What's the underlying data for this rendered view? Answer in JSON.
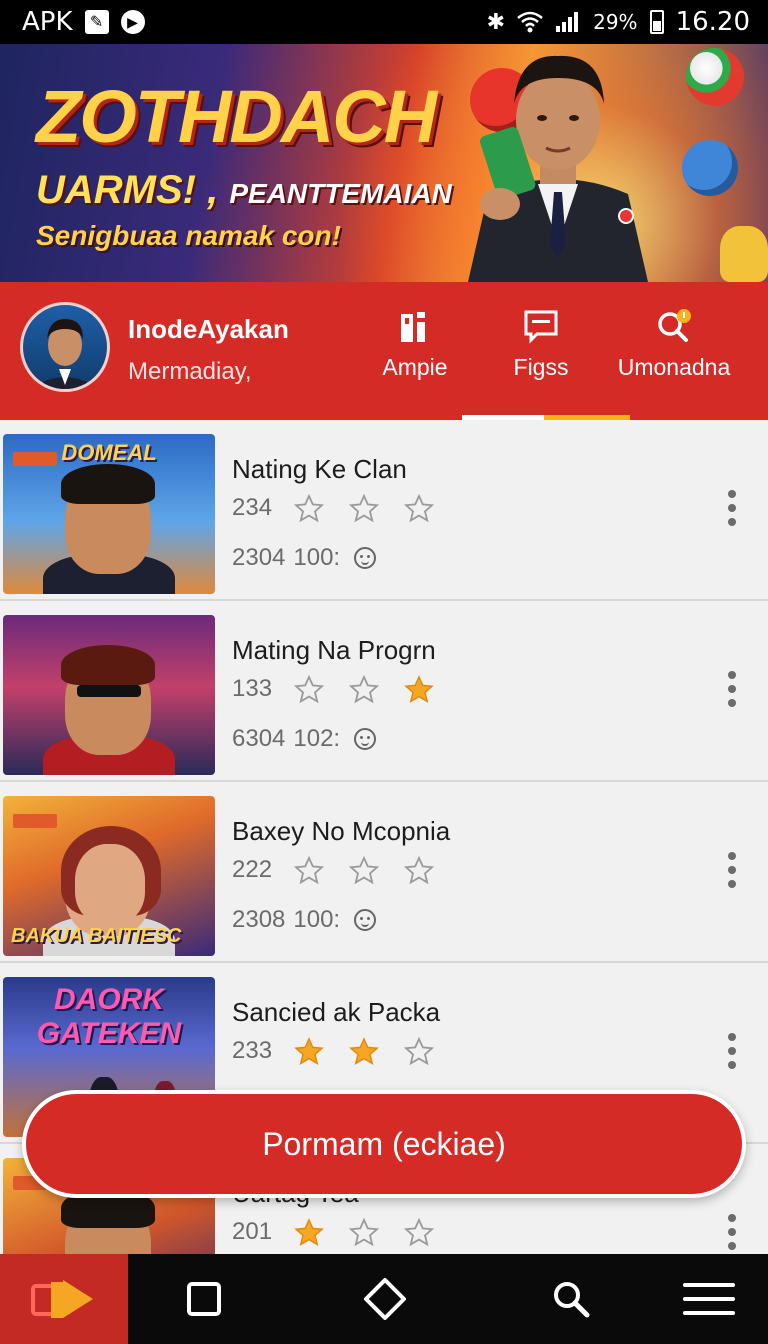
{
  "status_bar": {
    "left_text": "APK",
    "battery": "29%",
    "time": "16.20",
    "icons": [
      "notification-box-icon",
      "media-circle-icon",
      "bluetooth-icon",
      "wifi-icon",
      "signal-icon",
      "battery-icon"
    ]
  },
  "banner": {
    "title": "ZOTHDACH",
    "subtitle_main": "UARMS! ,",
    "subtitle_small": "PEANTTEMAIAN",
    "tagline": "Senigbuaa namak con!"
  },
  "header": {
    "user_name": "InodeAyakan",
    "user_sub": "Mermadiay,",
    "tabs": [
      {
        "label": "Ampie",
        "icon": "chart-icon"
      },
      {
        "label": "Figss",
        "icon": "chat-icon"
      },
      {
        "label": "Umonadna",
        "icon": "search-badge-icon"
      }
    ],
    "active_tab_color": "#ffffff",
    "accent_tab_color": "#f5b21a"
  },
  "list": {
    "items": [
      {
        "title": "Nating Ke Clan",
        "rating_count": "234",
        "stars_filled": 0,
        "meta_a": "2304",
        "meta_b": "100:",
        "thumb_logo": "DOMEAL"
      },
      {
        "title": "Mating Na Progrn",
        "rating_count": "133",
        "stars_filled_index": [
          2
        ],
        "meta_a": "6304",
        "meta_b": "102:",
        "thumb_logo": ""
      },
      {
        "title": "Baxey No Mcopnia",
        "rating_count": "222",
        "stars_filled": 0,
        "meta_a": "2308",
        "meta_b": "100:",
        "thumb_logo": "BAKUA BAITIESC"
      },
      {
        "title": "Sancied ak Packa",
        "rating_count": "233",
        "stars_filled_index": [
          0,
          1
        ],
        "meta_a": "",
        "meta_b": "",
        "thumb_logo": "DAORK GATEKEN"
      },
      {
        "title": "Uartag Tea",
        "rating_count": "201",
        "stars_filled_index": [
          0
        ],
        "meta_a": "",
        "meta_b": "",
        "thumb_logo": ""
      }
    ]
  },
  "cta": {
    "label": "Pormam (eckiae)"
  },
  "bottom_nav": {
    "items": [
      "app-logo-icon",
      "square-icon",
      "diamond-icon",
      "search-icon",
      "menu-icon"
    ]
  },
  "colors": {
    "brand_red": "#d42b26",
    "star_gold": "#f5a623",
    "star_outline": "#9a9a9a"
  }
}
